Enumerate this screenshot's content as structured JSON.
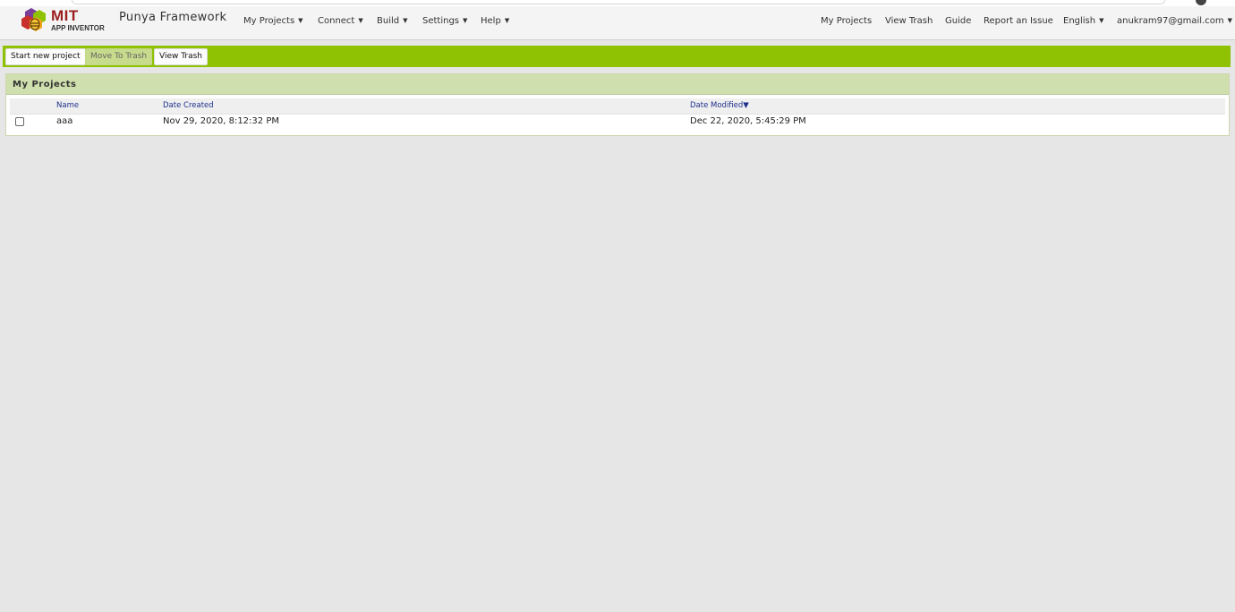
{
  "header": {
    "logo_top": "MIT",
    "logo_bottom": "APP INVENTOR",
    "brand": "Punya Framework",
    "left_menus": [
      {
        "label": "My Projects"
      },
      {
        "label": "Connect"
      },
      {
        "label": "Build"
      },
      {
        "label": "Settings"
      },
      {
        "label": "Help"
      }
    ],
    "right_links": [
      {
        "label": "My Projects"
      },
      {
        "label": "View Trash"
      },
      {
        "label": "Guide"
      },
      {
        "label": "Report an Issue"
      }
    ],
    "language": "English",
    "user_email": "anukram97@gmail.com"
  },
  "toolbar": {
    "start_new_project": "Start new project",
    "move_to_trash": "Move To Trash",
    "view_trash": "View Trash"
  },
  "panel": {
    "title": "My Projects",
    "columns": {
      "name": "Name",
      "date_created": "Date Created",
      "date_modified": "Date Modified▼"
    },
    "rows": [
      {
        "checked": false,
        "name": "aaa",
        "date_created": "Nov 29, 2020, 8:12:32 PM",
        "date_modified": "Dec 22, 2020, 5:45:29 PM"
      }
    ]
  },
  "colors": {
    "toolbar_green": "#8fc202",
    "panel_header": "#cfdfae",
    "link_blue": "#1d2f8c",
    "logo_red": "#9b1f1f"
  }
}
